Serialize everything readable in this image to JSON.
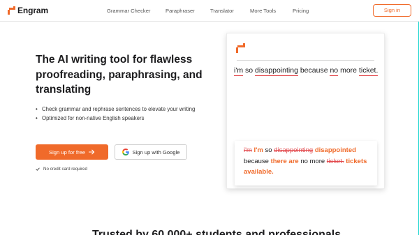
{
  "brand": {
    "name": "Engram",
    "accent": "#f06a2a",
    "error": "#e2474b"
  },
  "nav": {
    "items": [
      "Grammar Checker",
      "Paraphraser",
      "Translator",
      "More Tools",
      "Pricing"
    ],
    "signin_label": "Sign in"
  },
  "hero": {
    "headline": "The AI writing tool for flawless proofreading, paraphrasing, and translating",
    "bullets": [
      "Check grammar and rephrase sentences to elevate your writing",
      "Optimized for non-native English speakers"
    ],
    "signup_label": "Sign up for free",
    "google_label": "Sign up with Google",
    "note": "No credit card required"
  },
  "demo": {
    "sentence": {
      "w1": "i'm",
      "t1": "so",
      "w2": "disappointing",
      "t2": "because",
      "w3": "no",
      "t3": "more",
      "w4": "ticket."
    },
    "result": {
      "d1": "i'm",
      "i1": "I'm",
      "t1": "so",
      "d2": "disappointing",
      "i2": "disappointed",
      "t2": "because",
      "i3": "there are",
      "t3": "no more",
      "d3": "ticket.",
      "i4": "tickets available."
    }
  },
  "trusted": "Trusted by 60,000+ students and professionals"
}
